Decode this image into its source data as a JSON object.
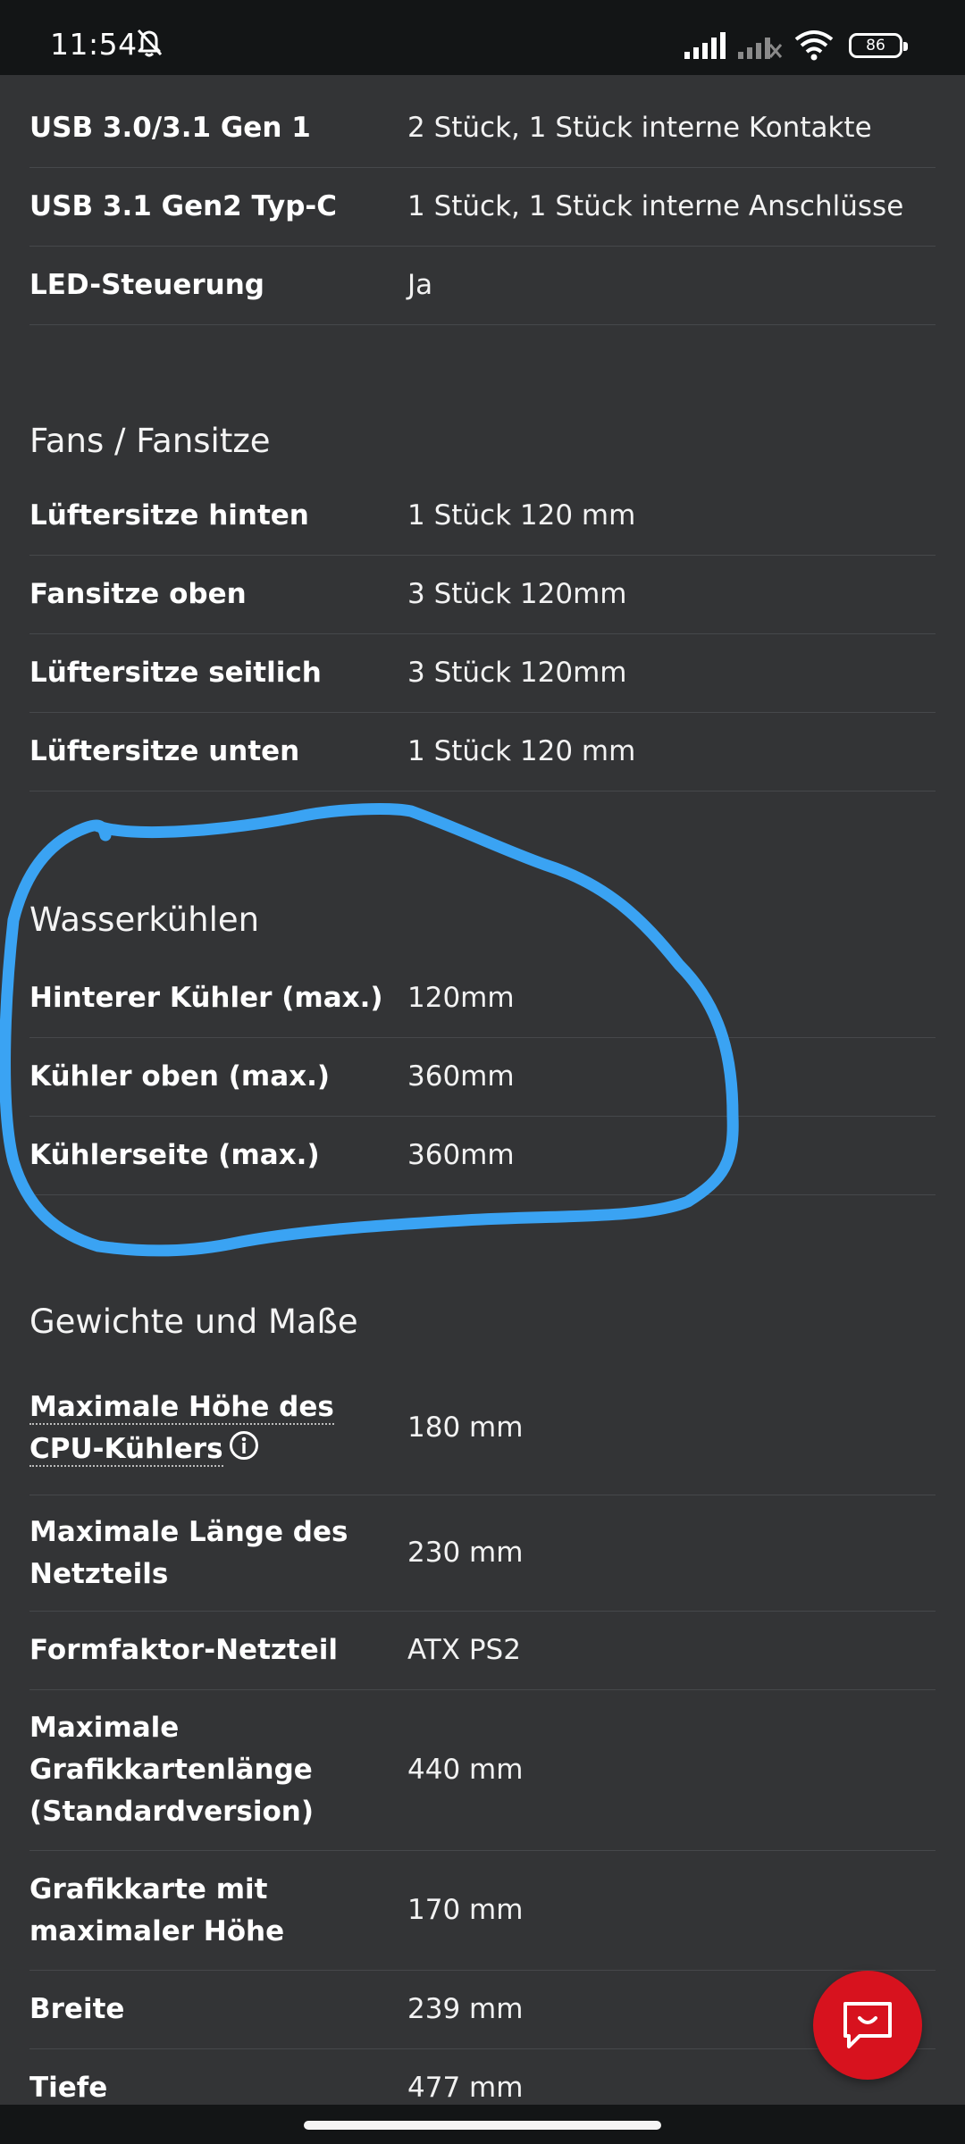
{
  "status_bar": {
    "time": "11:54",
    "battery": "86",
    "icons": [
      "bell-off-icon",
      "signal-icon",
      "signal-no-service-icon",
      "wifi-icon",
      "battery-icon"
    ]
  },
  "usb_rows": [
    {
      "label": "USB 3.0/3.1 Gen 1",
      "value": "2 Stück, 1 Stück interne Kontakte"
    },
    {
      "label": "USB 3.1 Gen2 Typ-C",
      "value": "1 Stück, 1 Stück interne Anschlüsse"
    },
    {
      "label": "LED-Steuerung",
      "value": "Ja"
    }
  ],
  "fans": {
    "title": "Fans / Fansitze",
    "rows": [
      {
        "label": "Lüftersitze hinten",
        "value": "1 Stück 120 mm"
      },
      {
        "label": "Fansitze oben",
        "value": "3 Stück 120mm"
      },
      {
        "label": "Lüftersitze seitlich",
        "value": "3 Stück 120mm"
      },
      {
        "label": "Lüftersitze unten",
        "value": "1 Stück 120 mm"
      }
    ]
  },
  "water": {
    "title": "Wasserkühlen",
    "rows": [
      {
        "label": "Hinterer Kühler (max.)",
        "value": "120mm"
      },
      {
        "label": "Kühler oben (max.)",
        "value": "360mm"
      },
      {
        "label": "Kühlerseite (max.)",
        "value": "360mm"
      }
    ]
  },
  "weights": {
    "title": "Gewichte und Maße",
    "rows": [
      {
        "label_line1": "Maximale Höhe des",
        "label_line2": "CPU-Kühlers",
        "value": "180 mm"
      },
      {
        "label_line1": "Maximale Länge des",
        "label_line2": "Netzteils",
        "value": "230 mm"
      },
      {
        "label": "Formfaktor-Netzteil",
        "value": "ATX PS2"
      },
      {
        "label_line1": "Maximale",
        "label_line2": "Grafikkartenlänge",
        "label_line3": "(Standardversion)",
        "value": "440 mm"
      },
      {
        "label_line1": "Grafikkarte mit",
        "label_line2": "maximaler Höhe",
        "value": "170 mm"
      },
      {
        "label": "Breite",
        "value": "239 mm"
      },
      {
        "label": "Tiefe",
        "value": "477 mm"
      }
    ]
  },
  "annotation_color": "#3aa3f3",
  "accent_color": "#d7121e"
}
